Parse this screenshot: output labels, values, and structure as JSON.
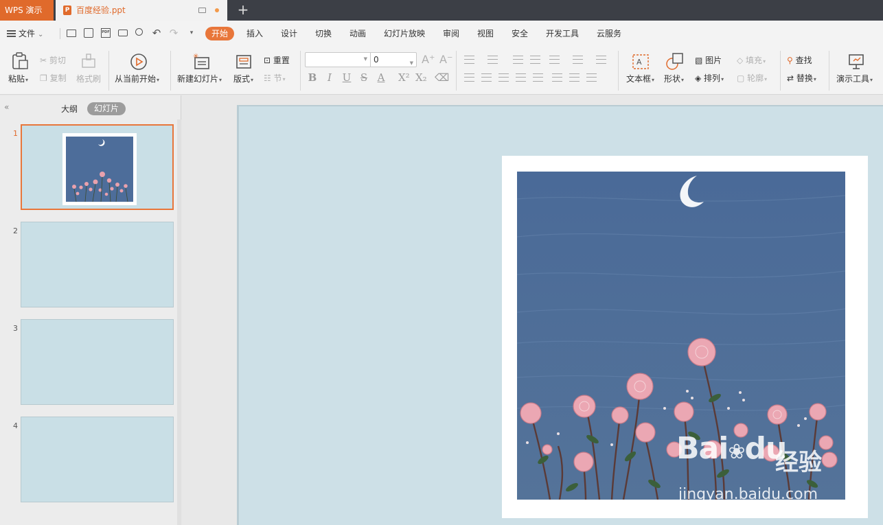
{
  "titlebar": {
    "app_name": "WPS 演示",
    "doc_name": "百度经验.ppt",
    "doc_badge": "P",
    "new_tab": "+"
  },
  "menubar": {
    "file_label": "文件",
    "items": [
      "开始",
      "插入",
      "设计",
      "切换",
      "动画",
      "幻灯片放映",
      "审阅",
      "视图",
      "安全",
      "开发工具",
      "云服务"
    ],
    "active": "开始"
  },
  "ribbon": {
    "paste": "粘贴",
    "cut": "剪切",
    "copy": "复制",
    "format_painter": "格式刷",
    "play_from_current": "从当前开始",
    "new_slide": "新建幻灯片",
    "layout": "版式",
    "reset": "重置",
    "section": "节",
    "font_name": "",
    "font_size": "0",
    "text_box": "文本框",
    "shape": "形状",
    "picture": "图片",
    "arrange": "排列",
    "fill": "填充",
    "outline": "轮廓",
    "find": "查找",
    "replace": "替换",
    "presentation_tools": "演示工具"
  },
  "left_panel": {
    "tab_outline": "大纲",
    "tab_slides": "幻灯片",
    "slides": [
      {
        "num": "1",
        "selected": true
      },
      {
        "num": "2",
        "selected": false
      },
      {
        "num": "3",
        "selected": false
      },
      {
        "num": "4",
        "selected": false
      }
    ]
  },
  "colors": {
    "accent": "#e8763a",
    "slide_bg": "#cde0e7",
    "painting_bg": "#4d6d9a"
  },
  "watermark": {
    "brand": "Bai",
    "brand2": "du",
    "suffix": "经验",
    "url": "jingyan.baidu.com"
  }
}
